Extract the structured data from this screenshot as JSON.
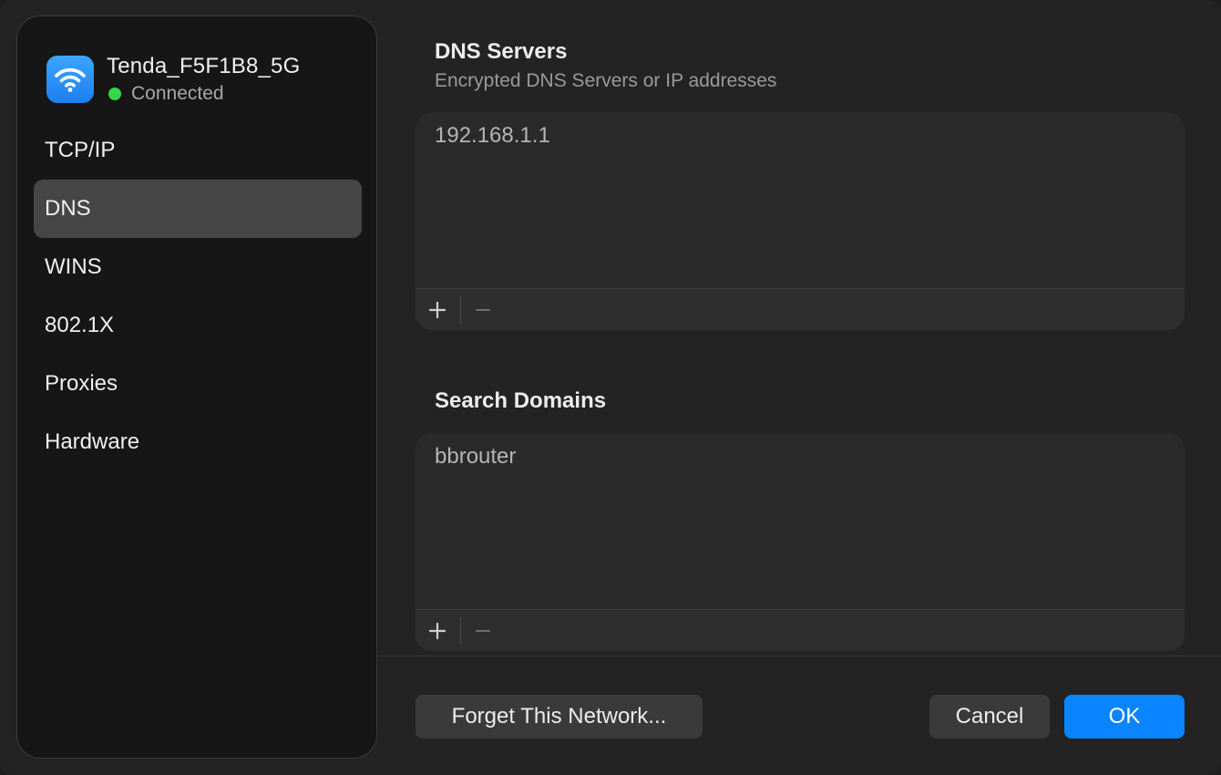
{
  "network": {
    "name": "Tenda_F5F1B8_5G",
    "status": "Connected",
    "icon": "wifi-icon",
    "status_color": "#32d74b"
  },
  "sidebar": {
    "items": [
      {
        "label": "TCP/IP",
        "selected": false
      },
      {
        "label": "DNS",
        "selected": true
      },
      {
        "label": "WINS",
        "selected": false
      },
      {
        "label": "802.1X",
        "selected": false
      },
      {
        "label": "Proxies",
        "selected": false
      },
      {
        "label": "Hardware",
        "selected": false
      }
    ]
  },
  "dns": {
    "title": "DNS Servers",
    "subtitle": "Encrypted DNS Servers or IP addresses",
    "entries": [
      "192.168.1.1"
    ]
  },
  "search_domains": {
    "title": "Search Domains",
    "entries": [
      "bbrouter"
    ]
  },
  "buttons": {
    "forget": "Forget This Network...",
    "cancel": "Cancel",
    "ok": "OK"
  },
  "colors": {
    "accent": "#0a84ff",
    "wifi_badge": "#1e7ff0"
  }
}
